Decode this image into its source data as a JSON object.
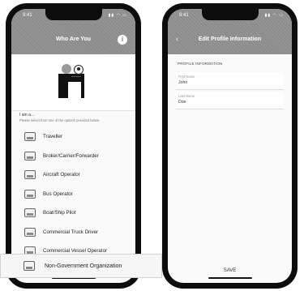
{
  "left_screen": {
    "status_time": "9:41",
    "title": "Who Are You",
    "section_title": "I am a...",
    "section_subtitle": "Please select from one of the options provided below",
    "items": [
      {
        "label": "Traveller",
        "icon": "traveller-icon"
      },
      {
        "label": "Broker/Carrier/Forwarder",
        "icon": "broker-icon"
      },
      {
        "label": "Aircraft Operator",
        "icon": "aircraft-icon"
      },
      {
        "label": "Bus Operator",
        "icon": "bus-icon"
      },
      {
        "label": "Boat/Ship Pilot",
        "icon": "boat-icon"
      },
      {
        "label": "Commercial Truck Driver",
        "icon": "truck-icon"
      },
      {
        "label": "Commercial Vessel Operator",
        "icon": "vessel-icon"
      }
    ]
  },
  "callout": {
    "label": "Non-Government Organization",
    "icon": "organization-icon"
  },
  "right_screen": {
    "status_time": "9:41",
    "title": "Edit Profile Information",
    "section_caption": "PROFILE INFORMATION",
    "fields": [
      {
        "label": "First Name",
        "value": "John"
      },
      {
        "label": "Last Name",
        "value": "Doe"
      }
    ],
    "save_label": "SAVE"
  }
}
